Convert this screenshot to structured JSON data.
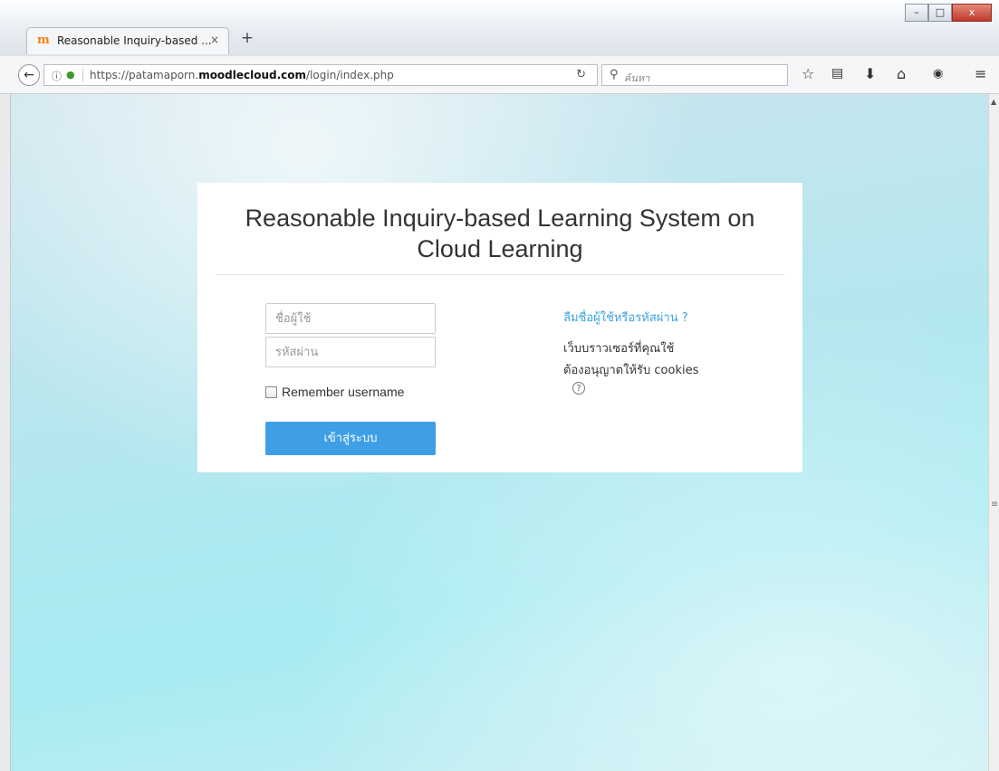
{
  "browser": {
    "tab_title": "Reasonable Inquiry-based ...",
    "tab_close": "×",
    "new_tab": "+",
    "url_prefix": "https://patamaporn.",
    "url_domain": "moodlecloud.com",
    "url_path": "/login/index.php",
    "search_placeholder": "ค้นหา",
    "window_buttons": {
      "minimize": "–",
      "maximize": "□",
      "close": "x"
    },
    "icons": [
      "back-arrow-icon",
      "info-icon",
      "lock-icon",
      "reload-icon",
      "search-icon",
      "bookmark-star-icon",
      "reading-list-icon",
      "download-icon",
      "home-icon",
      "pocket-icon",
      "menu-icon"
    ]
  },
  "login": {
    "heading": "Reasonable Inquiry-based Learning System on Cloud Learning",
    "username_placeholder": "ชื่อผู้ใช้",
    "password_placeholder": "รหัสผ่าน",
    "remember_label": "Remember username",
    "login_button": "เข้าสู่ระบบ",
    "forgot_link": "ลืมชื่อผู้ใช้หรือรหัสผ่าน ?",
    "cookies_line1": "เว็บบราวเซอร์ที่คุณใช้",
    "cookies_line2": "ต้องอนุญาตให้รับ cookies",
    "help_icon": "?"
  },
  "colors": {
    "accent": "#3e9fe6",
    "link": "#3da3e0",
    "moodle_orange": "#f98012"
  }
}
